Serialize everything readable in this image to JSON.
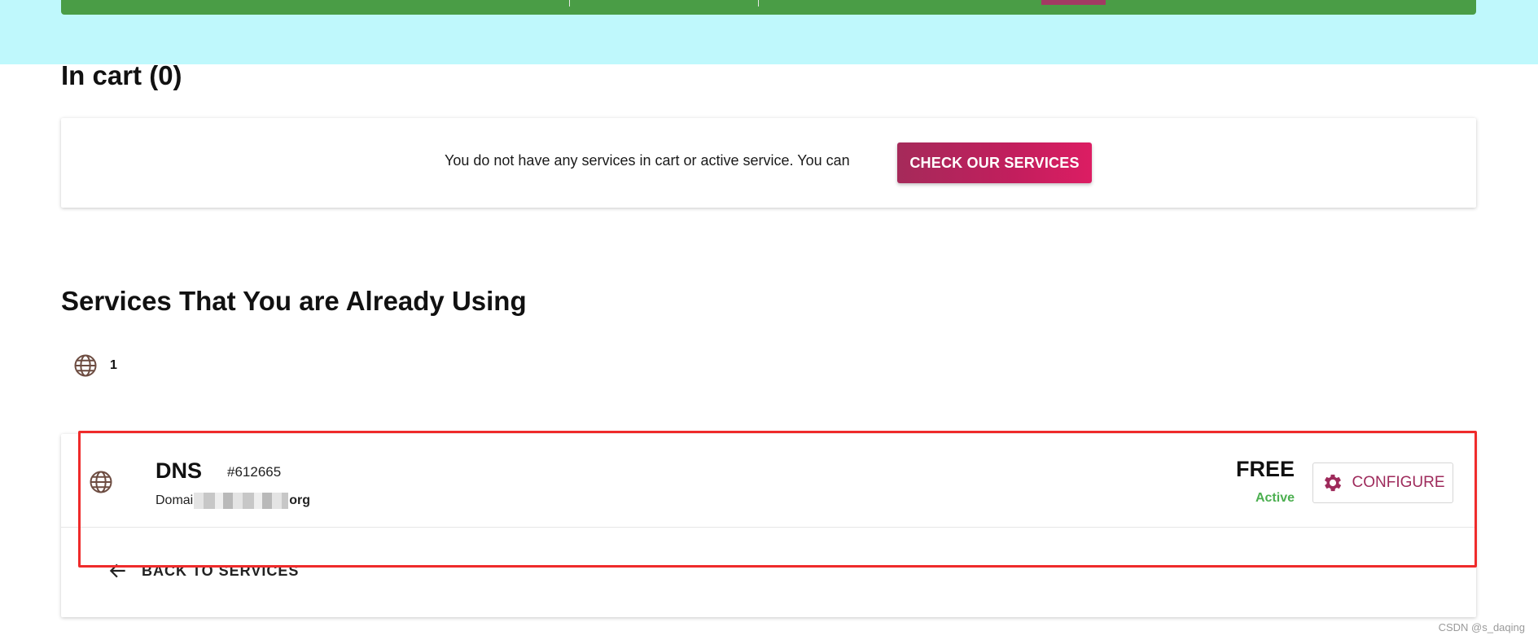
{
  "cart": {
    "title": "In cart (0)",
    "empty_message": "You do not have any services in cart or active service. You can",
    "cta_label": "CHECK OUR SERVICES"
  },
  "services": {
    "title": "Services That You are Already Using",
    "count": "1",
    "items": [
      {
        "name": "DNS",
        "id": "#612665",
        "domain_prefix": "Domai",
        "domain_suffix": "org",
        "price": "FREE",
        "status": "Active",
        "configure_label": "CONFIGURE"
      }
    ],
    "back_label": "BACK TO SERVICES"
  },
  "icons": {
    "count_icon": "globe-icon",
    "service_icon": "globe-icon",
    "configure_icon": "gear-icon",
    "back_icon": "arrow-left-icon"
  },
  "colors": {
    "accent": "#c21e5d",
    "accent_dark": "#9e2a5b",
    "status_active": "#4caf50",
    "top_band": "#bff8fc",
    "green_bar": "#4a9d46",
    "highlight": "#ef2b2b"
  },
  "watermark": "CSDN @s_daqing"
}
